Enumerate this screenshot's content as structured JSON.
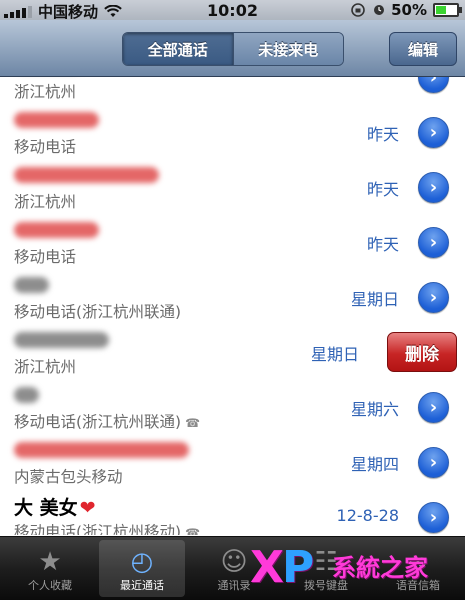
{
  "status_bar": {
    "carrier": "中国移动",
    "time": "10:02",
    "battery_percent": "50%",
    "battery_level": 0.5
  },
  "nav": {
    "segments": [
      "全部通话",
      "未接来电"
    ],
    "active_segment": 0,
    "edit_label": "编辑"
  },
  "calls": [
    {
      "name": "",
      "sub": "浙江杭州",
      "date": "",
      "name_color": "gray",
      "partial": true
    },
    {
      "name": "",
      "sub": "移动电话",
      "date": "昨天",
      "name_color": "red"
    },
    {
      "name": "",
      "sub": "浙江杭州",
      "date": "昨天",
      "name_color": "red"
    },
    {
      "name": "",
      "sub": "移动电话",
      "date": "昨天",
      "name_color": "red"
    },
    {
      "name": "",
      "sub": "移动电话(浙江杭州联通)",
      "date": "星期日",
      "name_color": "gray"
    },
    {
      "name": "",
      "sub": "浙江杭州",
      "date": "星期日",
      "name_color": "gray",
      "delete": "删除"
    },
    {
      "name": "",
      "sub": "移动电话(浙江杭州联通)",
      "date": "星期六",
      "name_color": "gray",
      "outgoing": true
    },
    {
      "name": "",
      "sub": "内蒙古包头移动",
      "date": "星期四",
      "name_color": "red"
    },
    {
      "name": "大 美女",
      "sub": "移动电话(浙江杭州移动)",
      "date": "12-8-28",
      "name_color": "black",
      "outgoing": true,
      "heart": true
    }
  ],
  "tabs": [
    {
      "label": "个人收藏",
      "icon": "star-icon"
    },
    {
      "label": "最近通话",
      "icon": "clock-icon",
      "active": true
    },
    {
      "label": "通讯录",
      "icon": "contacts-icon"
    },
    {
      "label": "拨号键盘",
      "icon": "keypad-icon"
    },
    {
      "label": "语音信箱",
      "icon": "voicemail-icon"
    }
  ],
  "watermark": {
    "brand": "XP",
    "text": "系統之家"
  }
}
